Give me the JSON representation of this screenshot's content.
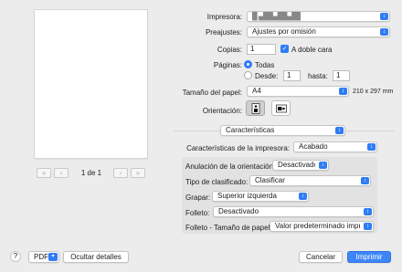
{
  "preview": {
    "prev_glyph": "«",
    "back_glyph": "‹",
    "page_indicator": "1 de 1",
    "forward_glyph": "›",
    "next_glyph": "»"
  },
  "printer": {
    "label": "Impresora:",
    "value": "█ ▄██▄██▄██"
  },
  "presets": {
    "label": "Preajustes:",
    "value": "Ajustes por omisión"
  },
  "copies": {
    "label": "Copias:",
    "value": "1",
    "two_sided_label": "A doble cara",
    "two_sided_checked": true
  },
  "pages": {
    "label": "Páginas:",
    "all_label": "Todas",
    "from_label": "Desde:",
    "from_value": "1",
    "to_label": "hasta:",
    "to_value": "1",
    "selected": "all"
  },
  "paper_size": {
    "label": "Tamaño del papel:",
    "value": "A4",
    "dimensions": "210 x 297 mm"
  },
  "orientation": {
    "label": "Orientación:",
    "selected": "portrait"
  },
  "section_popup": {
    "value": "Características"
  },
  "features": {
    "label": "Características de la impresora:",
    "value": "Acabado",
    "rows": [
      {
        "label": "Anulación de la orientación:",
        "value": "Desactivado"
      },
      {
        "label": "Tipo de clasificado:",
        "value": "Clasificar"
      },
      {
        "label": "Grapar:",
        "value": "Superior izquierda"
      },
      {
        "label": "Folleto:",
        "value": "Desactivado"
      },
      {
        "label": "Folleto - Tamaño de papel:",
        "value": "Valor predeterminado impr..."
      }
    ]
  },
  "footer": {
    "help_glyph": "?",
    "pdf_label": "PDF",
    "hide_details_label": "Ocultar detalles",
    "cancel_label": "Cancelar",
    "print_label": "Imprimir"
  },
  "colors": {
    "accent": "#2f7cf6",
    "primary_button": "#3e86f7",
    "background": "#ececec"
  }
}
